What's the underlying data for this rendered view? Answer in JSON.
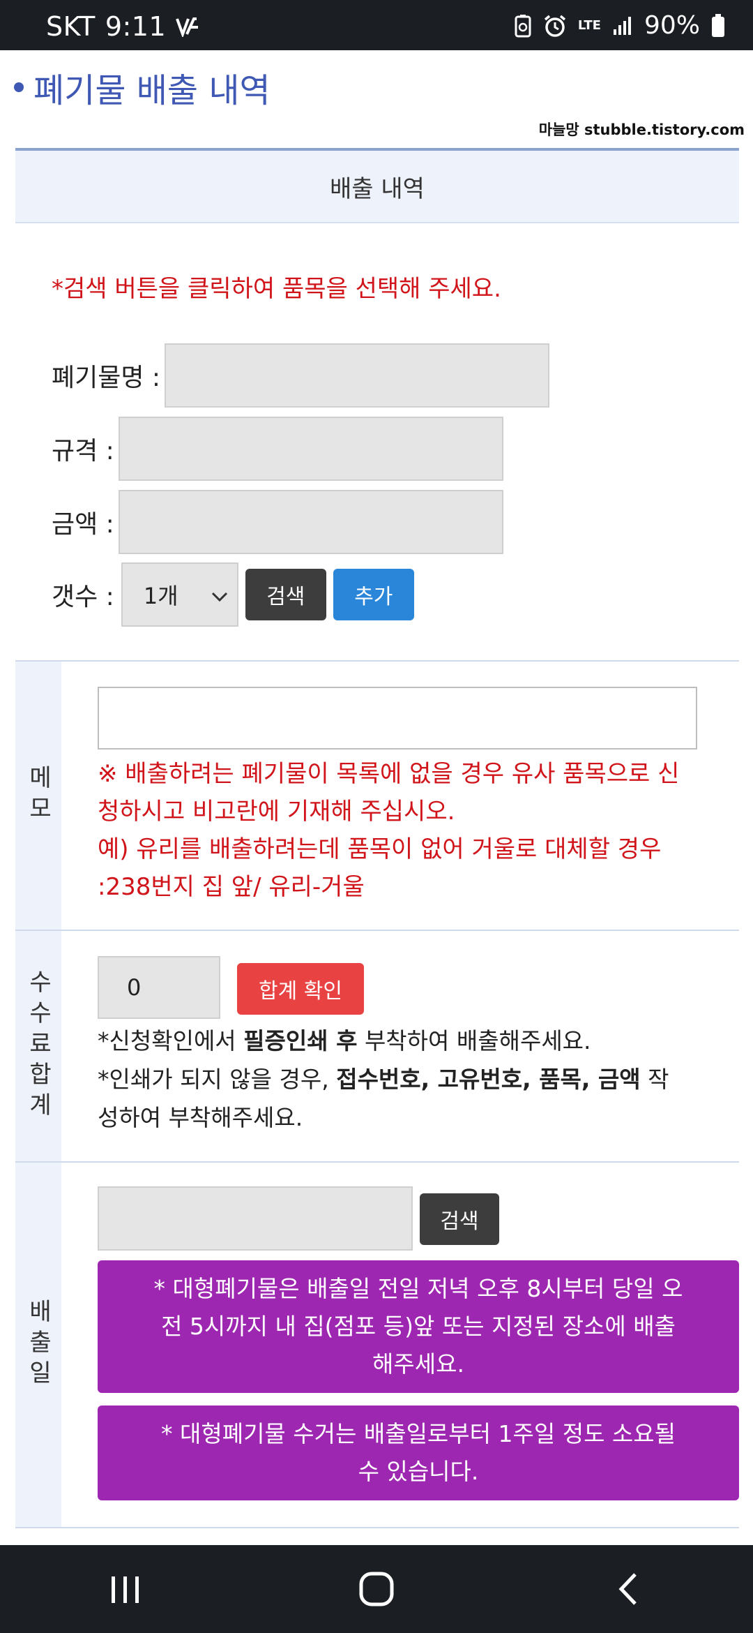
{
  "status_bar": {
    "carrier": "SKT",
    "time": "9:11",
    "network": "LTE",
    "battery": "90%"
  },
  "page": {
    "title": "폐기물 배출 내역",
    "watermark": "마늘망 stubble.tistory.com",
    "section_header": "배출 내역"
  },
  "form": {
    "notice": "*검색 버튼을 클릭하여 품목을 선택해 주세요.",
    "waste_name_label": "폐기물명 :",
    "spec_label": "규격 :",
    "amount_label": "금액 :",
    "count_label": "갯수 :",
    "count_value": "1개",
    "search_button": "검색",
    "add_button": "추가"
  },
  "memo": {
    "label": "메모",
    "note_line1": "※ 배출하려는 폐기물이 목록에 없을 경우 유사 품목으로 신",
    "note_line2": "청하시고 비고란에 기재해 주십시오.",
    "note_line3": "예) 유리를 배출하려는데 품목이 없어 거울로 대체할 경우",
    "note_line4": ":238번지 집 앞/ 유리-거울"
  },
  "fee": {
    "label": "수수료합계",
    "total_value": "0",
    "confirm_button": "합계 확인",
    "line1_pre": "*신청확인에서 ",
    "line1_bold": "필증인쇄 후",
    "line1_post": " 부착하여 배출해주세요.",
    "line2_pre": "*인쇄가 되지 않을 경우, ",
    "line2_bold": "접수번호, 고유번호, 품목, 금액",
    "line2_post": " 작",
    "line3": "성하여 부착해주세요."
  },
  "date": {
    "label": "배출일",
    "search_button": "검색",
    "notice1_line1": "* 대형폐기물은 배출일 전일 저녁 오후 8시부터 당일 오",
    "notice1_line2": "전 5시까지 내 집(점포 등)앞 또는 지정된 장소에 배출",
    "notice1_line3": "해주세요.",
    "notice2_line1": "* 대형폐기물 수거는 배출일로부터 1주일 정도 소요될",
    "notice2_line2": "수 있습니다."
  },
  "colors": {
    "title_blue": "#3f58b4",
    "notice_red": "#d0141a",
    "search_dark": "#3d3d3d",
    "add_blue": "#2a86d9",
    "confirm_red": "#e84342",
    "notice_purple": "#9d27b0"
  },
  "icons": [
    "signal-icon",
    "battery-icon",
    "alarm-icon",
    "recents-icon",
    "home-icon",
    "back-icon",
    "chevron-down-icon"
  ]
}
